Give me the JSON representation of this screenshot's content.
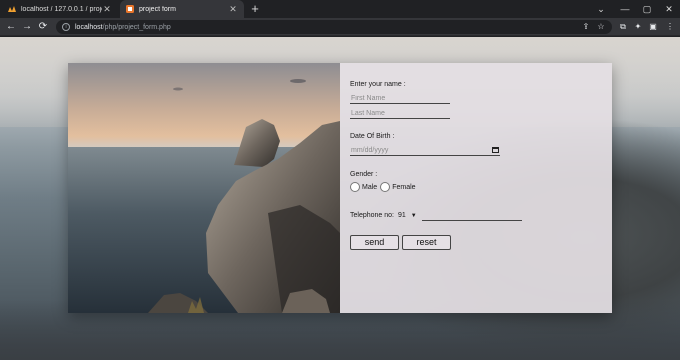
{
  "browser": {
    "tabs": [
      {
        "title": "localhost / 127.0.0.1 / project / p",
        "close": "✕"
      },
      {
        "title": "project form",
        "close": "✕"
      }
    ],
    "new_tab": "+",
    "window_controls": {
      "expand": "⌄",
      "minimize": "—",
      "maximize": "▢",
      "close": "✕"
    },
    "nav": {
      "back": "←",
      "forward": "→",
      "reload": "⟳"
    },
    "address": {
      "host": "localhost",
      "path": "/php/project_form.php"
    },
    "accent_tab_color": "#35363a"
  },
  "form": {
    "name_label": "Enter your name :",
    "first_name_placeholder": "First Name",
    "last_name_placeholder": "Last Name",
    "dob_label": "Date Of Birth :",
    "dob_placeholder": "mm/dd/yyyy",
    "gender_label": "Gender :",
    "gender_options": [
      "Male",
      "Female"
    ],
    "telephone_label": "Telephone no:",
    "country_code": "91",
    "send_label": "send",
    "reset_label": "reset"
  }
}
